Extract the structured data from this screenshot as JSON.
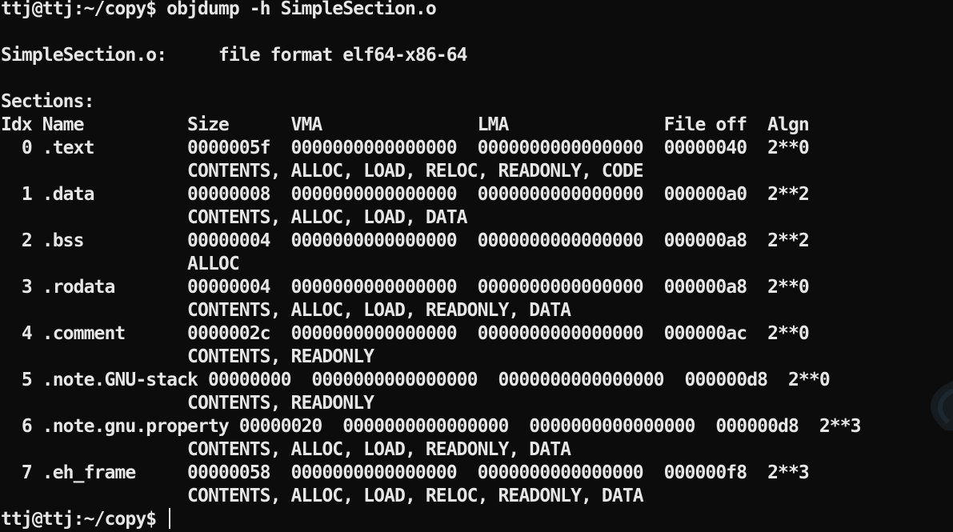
{
  "terminal": {
    "command_line": "ttj@ttj:~/copy$ objdump -h SimpleSection.o",
    "file_format_line": "SimpleSection.o:     file format elf64-x86-64",
    "sections_label": "Sections:",
    "header_row": "Idx Name          Size      VMA               LMA               File off  Algn",
    "sections": [
      {
        "row": "  0 .text         0000005f  0000000000000000  0000000000000000  00000040  2**0",
        "flags": "                  CONTENTS, ALLOC, LOAD, RELOC, READONLY, CODE"
      },
      {
        "row": "  1 .data         00000008  0000000000000000  0000000000000000  000000a0  2**2",
        "flags": "                  CONTENTS, ALLOC, LOAD, DATA"
      },
      {
        "row": "  2 .bss          00000004  0000000000000000  0000000000000000  000000a8  2**2",
        "flags": "                  ALLOC"
      },
      {
        "row": "  3 .rodata       00000004  0000000000000000  0000000000000000  000000a8  2**0",
        "flags": "                  CONTENTS, ALLOC, LOAD, READONLY, DATA"
      },
      {
        "row": "  4 .comment      0000002c  0000000000000000  0000000000000000  000000ac  2**0",
        "flags": "                  CONTENTS, READONLY"
      },
      {
        "row": "  5 .note.GNU-stack 00000000  0000000000000000  0000000000000000  000000d8  2**0",
        "flags": "                  CONTENTS, READONLY"
      },
      {
        "row": "  6 .note.gnu.property 00000020  0000000000000000  0000000000000000  000000d8  2**3",
        "flags": "                  CONTENTS, ALLOC, LOAD, READONLY, DATA"
      },
      {
        "row": "  7 .eh_frame     00000058  0000000000000000  0000000000000000  000000f8  2**3",
        "flags": "                  CONTENTS, ALLOC, LOAD, RELOC, READONLY, DATA"
      }
    ],
    "prompt": "ttj@ttj:~/copy$ "
  }
}
